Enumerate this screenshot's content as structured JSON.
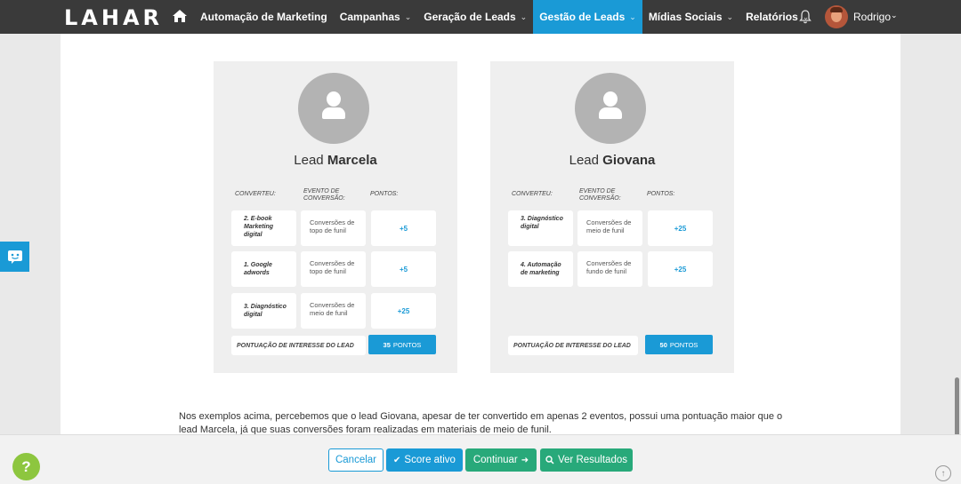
{
  "nav": {
    "logo": "LAHAR",
    "menu": [
      {
        "label": "Automação de Marketing",
        "chevron": false,
        "active": false
      },
      {
        "label": "Campanhas",
        "chevron": true,
        "active": false
      },
      {
        "label": "Geração de Leads",
        "chevron": true,
        "active": false
      },
      {
        "label": "Gestão de Leads",
        "chevron": true,
        "active": true
      },
      {
        "label": "Mídias Sociais",
        "chevron": true,
        "active": false
      },
      {
        "label": "Relatórios",
        "chevron": true,
        "active": false
      }
    ],
    "user_name": "Rodrigo"
  },
  "headers": {
    "converted": "CONVERTEU:",
    "event": "EVENTO DE CONVERSÃO:",
    "points": "PONTOS:"
  },
  "cards": [
    {
      "prefix": "Lead",
      "name": "Marcela",
      "rows": [
        {
          "converted": "2. E-book Marketing digital",
          "event": "Conversões de topo de funil",
          "points": "+5"
        },
        {
          "converted": "1. Google adwords",
          "event": "Conversões de topo de funil",
          "points": "+5"
        },
        {
          "converted": "3. Diagnóstico digital",
          "event": "Conversões de meio de funil",
          "points": "+25"
        }
      ],
      "score_label": "PONTUAÇÃO DE INTERESSE DO LEAD",
      "score_value": "35",
      "score_unit": "PONTOS"
    },
    {
      "prefix": "Lead",
      "name": "Giovana",
      "rows": [
        {
          "converted": "3. Diagnóstico digital",
          "event": "Conversões de meio de funil",
          "points": "+25"
        },
        {
          "converted": "4. Automação de marketing",
          "event": "Conversões de fundo de funil",
          "points": "+25"
        }
      ],
      "score_label": "PONTUAÇÃO DE INTERESSE DO LEAD",
      "score_value": "50",
      "score_unit": "PONTOS"
    }
  ],
  "paragraph": "Nos exemplos acima, percebemos que o lead Giovana, apesar de ter convertido em apenas 2 eventos, possui uma pontuação maior que o lead Marcela, já que suas conversões foram realizadas em materiais de meio de funil.",
  "buttons": {
    "cancel": "Cancelar",
    "score": "Score ativo",
    "next": "Continuar",
    "results": "Ver Resultados"
  },
  "help": "?",
  "colors": {
    "primary": "#1a9ad6",
    "success": "#28a97a",
    "nav_bg": "#3a3a3a",
    "help": "#8dc63f"
  },
  "icons": [
    "home-icon",
    "bell-icon",
    "user-placeholder-icon",
    "check-icon",
    "arrow-right-icon",
    "search-icon",
    "chat-icon",
    "arrow-up-icon"
  ]
}
